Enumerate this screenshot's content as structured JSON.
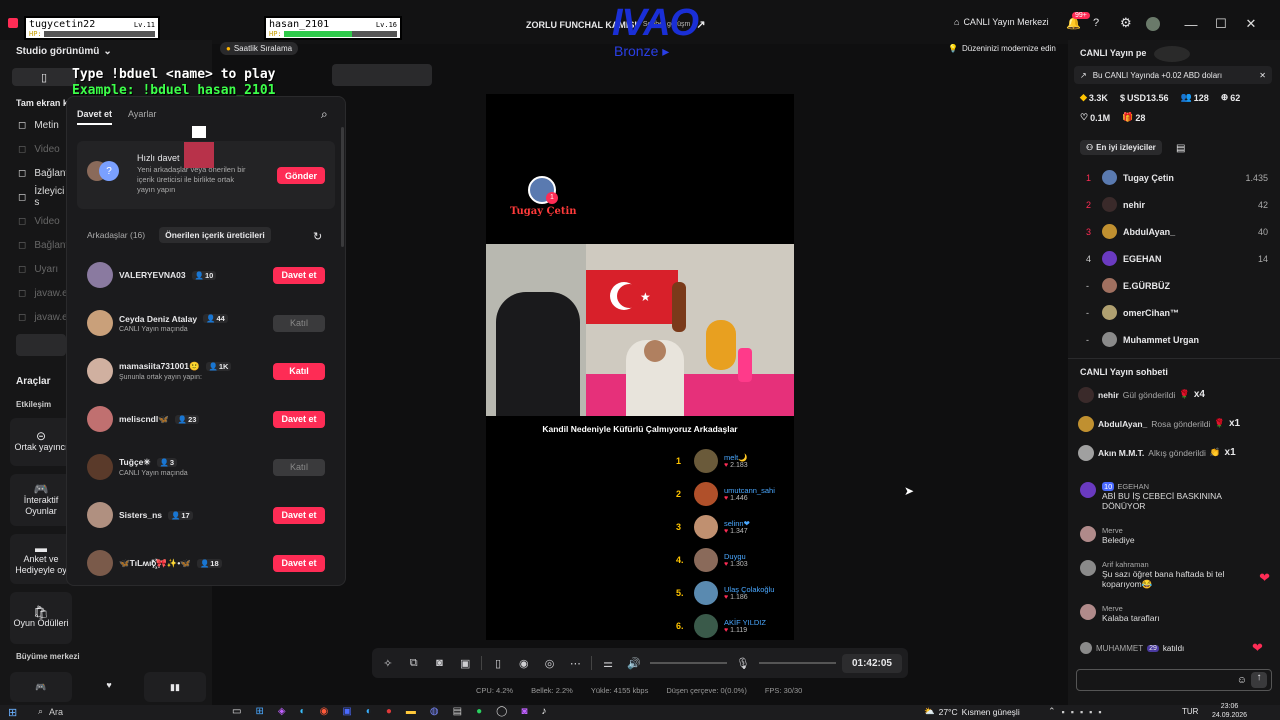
{
  "window": {
    "app_icon": "tiktok-live-studio-icon",
    "title": "ZORLU FUNCHAL KAMIŞI",
    "title_extra": "Sohbet görüşm",
    "notif_badge": "99+",
    "live_center": "CANLI Yayın Merkezi",
    "modernize": "Düzeninizi modernize edin"
  },
  "overlay": {
    "p1_name": "tugycetin22",
    "p1_lv": "Lv.11",
    "p2_name": "hasan_2101",
    "p2_lv": "Lv.16",
    "hp_label": "HP:",
    "p1_hp": 0,
    "p2_hp": 0.6,
    "ivao": "IVAO",
    "ivao_sub": "Bronze ▸",
    "bduel_line1": "Type !bduel <name> to play",
    "bduel_line2": "Example: !bduel hasan_2101",
    "ranking": "Saatlik Sıralama"
  },
  "sidebar": {
    "studio_view": "Studio görünümü",
    "fullscreen": "Tam ekran k",
    "items": [
      {
        "icon": "text-icon",
        "label": "Metin",
        "dim": false
      },
      {
        "icon": "video-icon",
        "label": "Video",
        "dim": true
      },
      {
        "icon": "globe-icon",
        "label": "Bağlantı",
        "dim": false
      },
      {
        "icon": "viewer-icon",
        "label": "İzleyici s",
        "dim": false
      },
      {
        "icon": "video-icon",
        "label": "Video",
        "dim": true
      },
      {
        "icon": "globe-icon",
        "label": "Bağlantı",
        "dim": true
      },
      {
        "icon": "app-icon",
        "label": "Uyarı",
        "dim": true
      },
      {
        "icon": "app-icon",
        "label": "javaw.e",
        "dim": true
      },
      {
        "icon": "app-icon",
        "label": "javaw.e",
        "dim": true
      }
    ],
    "tools_title": "Araçlar",
    "interaction": "Etkileşim",
    "cohost": "Ortak yayıncı",
    "interactive_games": "İnteraktif Oyunlar",
    "poll": "Anket ve Hediyeyle oy",
    "game_rewards": "Oyun Ödülleri",
    "growth": "Büyüme merkezi"
  },
  "invite": {
    "tab_invite": "Davet et",
    "tab_settings": "Ayarlar",
    "quick_title": "Hızlı davet",
    "quick_desc": "Yeni arkadaşlar veya önerilen bir içerik üreticisi ile birlikte ortak yayın yapın",
    "send": "Gönder",
    "friends_tab": "Arkadaşlar (16)",
    "suggested_tab": "Önerilen içerik üreticileri",
    "rows": [
      {
        "name": "VALERYEVNA03",
        "count": "10",
        "sub": "",
        "btn": "Davet et",
        "btn_type": "red",
        "color": "#8a7aa0"
      },
      {
        "name": "Ceyda Deniz Atalay",
        "count": "44",
        "sub": "CANLI Yayın maçında",
        "btn": "Katıl",
        "btn_type": "grey",
        "color": "#c9a07a"
      },
      {
        "name": "mamasiita731001🙂",
        "count": "1K",
        "sub": "Şununla ortak yayın yapın:",
        "btn": "Katıl",
        "btn_type": "red",
        "color": "#d0b0a0"
      },
      {
        "name": "meliscndl🦋",
        "count": "23",
        "sub": "",
        "btn": "Davet et",
        "btn_type": "red",
        "color": "#c07070"
      },
      {
        "name": "Tuğçe✳",
        "count": "3",
        "sub": "CANLI Yayın maçında",
        "btn": "Katıl",
        "btn_type": "grey",
        "color": "#5a3a2a"
      },
      {
        "name": "Sisters_ns",
        "count": "17",
        "sub": "",
        "btn": "Davet et",
        "btn_type": "red",
        "color": "#b09080"
      },
      {
        "name": "🦋TıLʍıᱠ꙰🎀✨•🦋",
        "count": "18",
        "sub": "",
        "btn": "Davet et",
        "btn_type": "red",
        "color": "#7a5a4a"
      }
    ]
  },
  "stream": {
    "host": "Tugay Çetin",
    "caption": "Kandil Nedeniyle Küfürlü Çalmıyoruz Arkadaşlar",
    "leaders": [
      {
        "rank": "1",
        "name": "melt🌙",
        "score": "2.183",
        "color": "#6a5a3a"
      },
      {
        "rank": "2",
        "name": "umutcann_sahi",
        "score": "1.446",
        "color": "#b0502a"
      },
      {
        "rank": "3",
        "name": "selinn❤",
        "score": "1.347",
        "color": "#c09070"
      },
      {
        "rank": "4.",
        "name": "Duygu",
        "score": "1.303",
        "color": "#8a6a5a"
      },
      {
        "rank": "5.",
        "name": "Ulaş Çolakoğlu",
        "score": "1.186",
        "color": "#5a8ab0"
      },
      {
        "rank": "6.",
        "name": "AKİF YILDIZ",
        "score": "1.119",
        "color": "#3a5a4a"
      }
    ]
  },
  "controls": {
    "timer": "01:42:05"
  },
  "stats": {
    "cpu": "CPU: 4.2%",
    "mem": "Bellek: 2.2%",
    "upload": "Yükle: 4155 kbps",
    "drop": "Düşen çerçeve: 0(0.0%)",
    "fps": "FPS: 30/30"
  },
  "right": {
    "title": "CANLI Yayın pe",
    "banner": "Bu CANLI Yayında +0.02 ABD doları",
    "diamonds": "3.3K",
    "usd": "USD13.56",
    "viewers": "128",
    "followers": "62",
    "likes": "0.1M",
    "gifts": "28",
    "top_viewers": "En iyi izleyiciler",
    "leaderboard": [
      {
        "rank": "1",
        "name": "Tugay Çetin",
        "score": "1.435",
        "color": "#5a7ab0",
        "red": true
      },
      {
        "rank": "2",
        "name": "nehir",
        "score": "42",
        "color": "#3a2a2a",
        "red": true
      },
      {
        "rank": "3",
        "name": "AbdulAyan_",
        "score": "40",
        "color": "#c09030",
        "red": true
      },
      {
        "rank": "4",
        "name": "EGEHAN",
        "score": "14",
        "color": "#6a3ac0",
        "red": false
      },
      {
        "rank": "-",
        "name": "E.GÜRBÜZ",
        "score": "",
        "color": "#a07060",
        "red": false
      },
      {
        "rank": "-",
        "name": "omerCihan™",
        "score": "",
        "color": "#b0a070",
        "red": false
      },
      {
        "rank": "-",
        "name": "Muhammet Urgan",
        "score": "",
        "color": "#8a8a8a",
        "red": false
      }
    ],
    "chat_title": "CANLI Yayın sohbeti",
    "gifts_list": [
      {
        "name": "nehir",
        "text": "Gül gönderildi",
        "count": "x4",
        "gift": "🌹",
        "color": "#3a2a2a"
      },
      {
        "name": "AbdulAyan_",
        "text": "Rosa gönderildi",
        "count": "x1",
        "gift": "🌹",
        "color": "#c09030"
      },
      {
        "name": "Akın M.M.T.",
        "text": "Alkış gönderildi",
        "count": "x1",
        "gift": "👏",
        "color": "#a0a0a0"
      }
    ],
    "messages": [
      {
        "badge": "10",
        "name": "EGEHAN",
        "text": "ABİ BU İŞ CEBECİ BASKININA DÖNÜYOR",
        "color": "#6a3ac0",
        "heart": false
      },
      {
        "badge": "",
        "name": "Merve",
        "text": "Belediye",
        "color": "#b08a8a",
        "heart": false
      },
      {
        "badge": "",
        "name": "Arif kahraman",
        "text": "Şu sazı öğret bana haftada bi tel koparıyom😂",
        "color": "#8a8a8a",
        "heart": true
      },
      {
        "badge": "",
        "name": "Merve",
        "text": "Kalaba tarafları",
        "color": "#b08a8a",
        "heart": false
      }
    ],
    "join_name": "MUHAMMET",
    "join_badge": "29",
    "join_text": "katıldı"
  },
  "taskbar": {
    "search": "Ara",
    "weather": "27°C",
    "weather_desc": "Kısmen güneşli",
    "lang": "TUR",
    "time": "23:06",
    "date": "24.09.2026"
  }
}
